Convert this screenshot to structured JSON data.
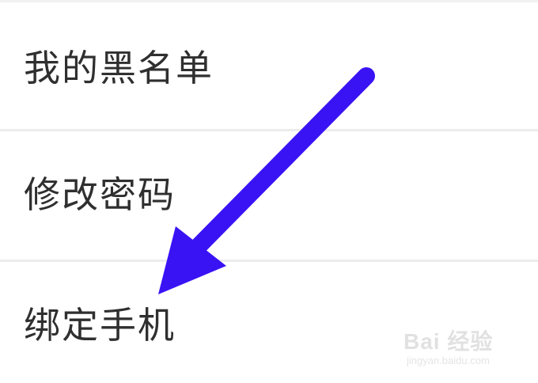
{
  "menu": {
    "items": [
      {
        "label": "我的黑名单"
      },
      {
        "label": "修改密码"
      },
      {
        "label": "绑定手机"
      }
    ]
  },
  "annotation": {
    "arrow_color": "#3a13f5",
    "arrow_target": "绑定手机"
  },
  "watermark": {
    "logo": "Bai 经验",
    "url": "jingyan.baidu.com"
  },
  "colors": {
    "text": "#2f2f2f",
    "divider": "#ececec",
    "background": "#ffffff"
  }
}
